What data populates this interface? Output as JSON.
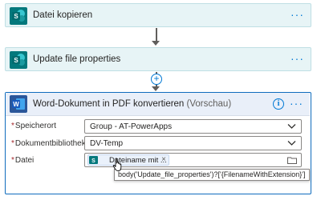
{
  "steps": [
    {
      "title": "Datei kopieren",
      "icon": "sharepoint-icon"
    },
    {
      "title": "Update file properties",
      "icon": "sharepoint-icon"
    }
  ],
  "more_label": "···",
  "add_step_label": "+",
  "word_action": {
    "title": "Word-Dokument in PDF konvertieren",
    "preview": "(Vorschau)",
    "icon": "word-icon",
    "info_label": "i",
    "fields": {
      "speicherort": {
        "label": "Speicherort",
        "value": "Group - AT-PowerApps"
      },
      "bibliothek": {
        "label": "Dokumentbibliothek",
        "value": "DV-Temp"
      },
      "datei": {
        "label": "Datei",
        "token_label": "Dateiname mit ...",
        "token_remove": "×",
        "tooltip": "body('Update_file_properties')?['{FilenameWithExtension}']"
      }
    },
    "required_marker": "*"
  },
  "colors": {
    "accent": "#0078d4",
    "sharepoint": "#03787c",
    "word": "#2b579a",
    "required": "#a4262c"
  }
}
